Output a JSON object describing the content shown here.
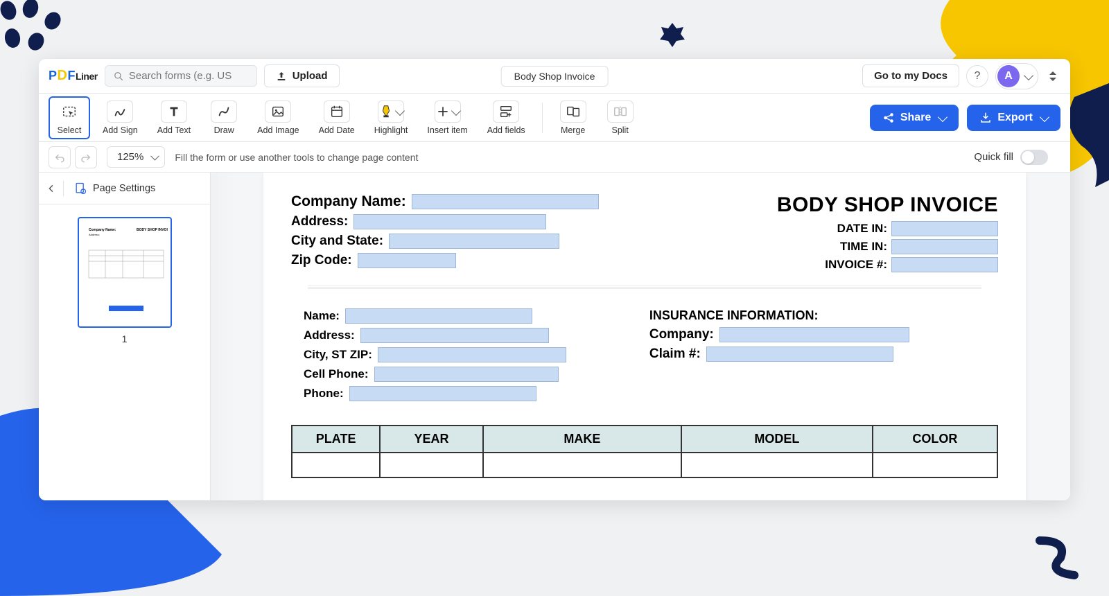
{
  "app": {
    "logo": {
      "p": "P",
      "d": "D",
      "f": "F",
      "liner": "Liner"
    },
    "search_placeholder": "Search forms (e.g. US",
    "upload_label": "Upload",
    "document_title": "Body Shop Invoice",
    "go_to_docs": "Go to my Docs",
    "help": "?",
    "avatar_initial": "A"
  },
  "toolbar": {
    "select": "Select",
    "add_sign": "Add Sign",
    "add_text": "Add Text",
    "draw": "Draw",
    "add_image": "Add Image",
    "add_date": "Add Date",
    "highlight": "Highlight",
    "insert_item": "Insert item",
    "add_fields": "Add fields",
    "merge": "Merge",
    "split": "Split",
    "share": "Share",
    "export": "Export"
  },
  "subbar": {
    "zoom": "125%",
    "hint": "Fill the form or use another tools to change page content",
    "quickfill": "Quick fill"
  },
  "sidebar": {
    "page_settings": "Page Settings",
    "thumb_label": "1"
  },
  "doc": {
    "title": "BODY SHOP INVOICE",
    "company": {
      "company_name": "Company Name:",
      "address": "Address:",
      "city_state": "City and State:",
      "zip": "Zip Code:"
    },
    "meta": {
      "date_in": "DATE IN:",
      "time_in": "TIME IN:",
      "invoice_no": "INVOICE #:"
    },
    "customer": {
      "name": "Name:",
      "address": "Address:",
      "city_st_zip": "City, ST ZIP:",
      "cell": "Cell Phone:",
      "phone": "Phone:"
    },
    "insurance": {
      "heading": "INSURANCE INFORMATION:",
      "company": "Company:",
      "claim": "Claim #:"
    },
    "vehicle_headers": [
      "PLATE",
      "YEAR",
      "MAKE",
      "MODEL",
      "COLOR"
    ]
  }
}
